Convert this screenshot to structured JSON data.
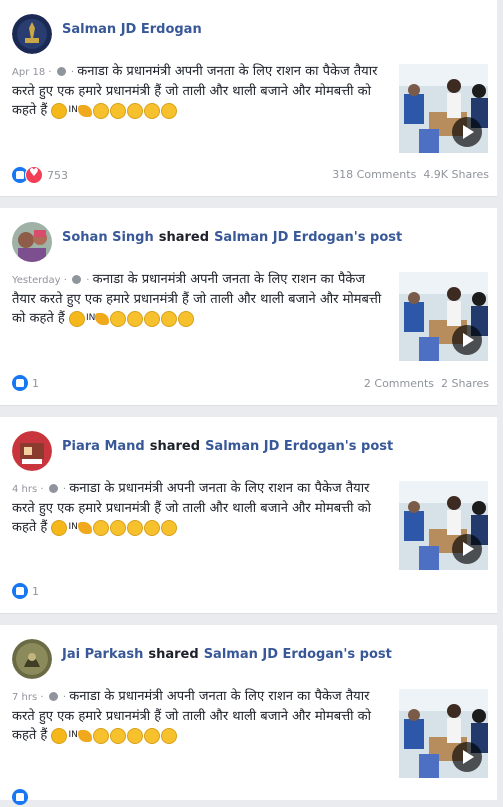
{
  "posts": [
    {
      "author": "Salman JD Erdogan",
      "shared": "",
      "source": "",
      "time": "Apr 18",
      "text": "कनाडा के प्रधानमंत्री अपनी जनता के लिए राशन का पैकेज तैयार करते हुए एक हमारे प्रधानमंत्री हैं जो ताली और थाली बजाने और मोमबत्ती को कहते हैं",
      "in_label": "IN",
      "reactions": "753",
      "comments": "318 Comments",
      "shares": "4.9K Shares"
    },
    {
      "author": "Sohan Singh",
      "shared": "shared",
      "source": "Salman JD Erdogan's post",
      "time": "Yesterday",
      "text": "कनाडा के प्रधानमंत्री अपनी जनता के लिए राशन का पैकेज तैयार करते हुए एक हमारे प्रधानमंत्री हैं जो ताली और थाली बजाने और मोमबत्ती को कहते हैं",
      "in_label": "IN",
      "reactions": "1",
      "comments": "2 Comments",
      "shares": "2 Shares"
    },
    {
      "author": "Piara Mand",
      "shared": "shared",
      "source": "Salman JD Erdogan's post",
      "time": "4 hrs",
      "text": "कनाडा के प्रधानमंत्री अपनी जनता के लिए राशन का पैकेज तैयार करते हुए एक हमारे प्रधानमंत्री हैं जो ताली और थाली बजाने और मोमबत्ती को कहते हैं",
      "in_label": "IN",
      "reactions": "1",
      "comments": "",
      "shares": ""
    },
    {
      "author": "Jai Parkash",
      "shared": "shared",
      "source": "Salman JD Erdogan's post",
      "time": "7 hrs",
      "text": "कनाडा के प्रधानमंत्री अपनी जनता के लिए राशन का पैकेज तैयार करते हुए एक हमारे प्रधानमंत्री हैं जो ताली और थाली बजाने और मोमबत्ती को कहते हैं",
      "in_label": "IN",
      "reactions": "",
      "comments": "",
      "shares": ""
    }
  ],
  "icons": {
    "like": "like-icon",
    "love": "love-icon",
    "play": "play-icon",
    "globe": "globe-icon"
  },
  "colors": {
    "link": "#385898",
    "like": "#1877f2",
    "love": "#f33e58"
  }
}
